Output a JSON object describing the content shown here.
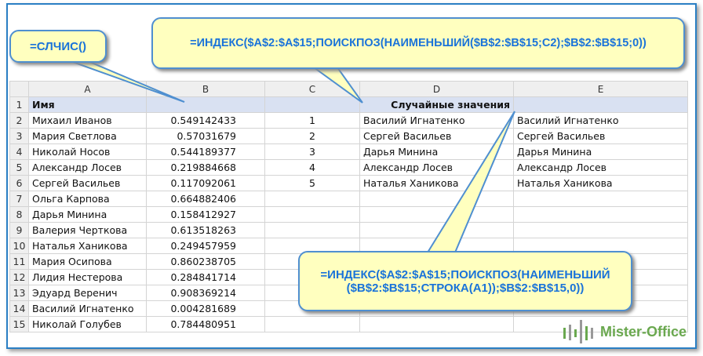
{
  "callouts": {
    "rand": "=СЛЧИС()",
    "top": "=ИНДЕКС($A$2:$A$15;ПОИСКПОЗ(НАИМЕНЬШИЙ($B$2:$B$15;C2);$B$2:$B$15;0))",
    "bottom_line1": "=ИНДЕКС($A$2:$A$15;ПОИСКПОЗ(НАИМЕНЬШИЙ",
    "bottom_line2": "($B$2:$B$15;СТРОКА(A1));$B$2:$B$15,0))"
  },
  "columns": [
    "A",
    "B",
    "C",
    "D",
    "E"
  ],
  "header": {
    "a": "Имя",
    "d": "Случайные значения"
  },
  "rows": [
    [
      "Михаил Иванов",
      "0.549142433",
      "1",
      "Василий Игнатенко",
      "Василий Игнатенко"
    ],
    [
      "Мария Светлова",
      "0.57031679",
      "2",
      "Сергей Васильев",
      "Сергей Васильев"
    ],
    [
      "Николай Носов",
      "0.544189377",
      "3",
      "Дарья Минина",
      "Дарья Минина"
    ],
    [
      "Александр Лосев",
      "0.219884668",
      "4",
      "Александр Лосев",
      "Александр Лосев"
    ],
    [
      "Сергей Васильев",
      "0.117092061",
      "5",
      "Наталья Ханикова",
      "Наталья Ханикова"
    ],
    [
      "Ольга Карпова",
      "0.664882406",
      "",
      "",
      ""
    ],
    [
      "Дарья Минина",
      "0.158412927",
      "",
      "",
      ""
    ],
    [
      "Валерия Черткова",
      "0.613518263",
      "",
      "",
      ""
    ],
    [
      "Наталья Ханикова",
      "0.249457959",
      "",
      "",
      ""
    ],
    [
      "Мария Осипова",
      "0.860238705",
      "",
      "",
      ""
    ],
    [
      "Лидия Нестерова",
      "0.284841714",
      "",
      "",
      ""
    ],
    [
      "Эдуард Веренич",
      "0.908369214",
      "",
      "",
      ""
    ],
    [
      "Василий Игнатенко",
      "0.004281689",
      "",
      "",
      ""
    ],
    [
      "Николай Голубев",
      "0.784480951",
      "",
      "",
      ""
    ]
  ],
  "logo": "Mister-Office"
}
